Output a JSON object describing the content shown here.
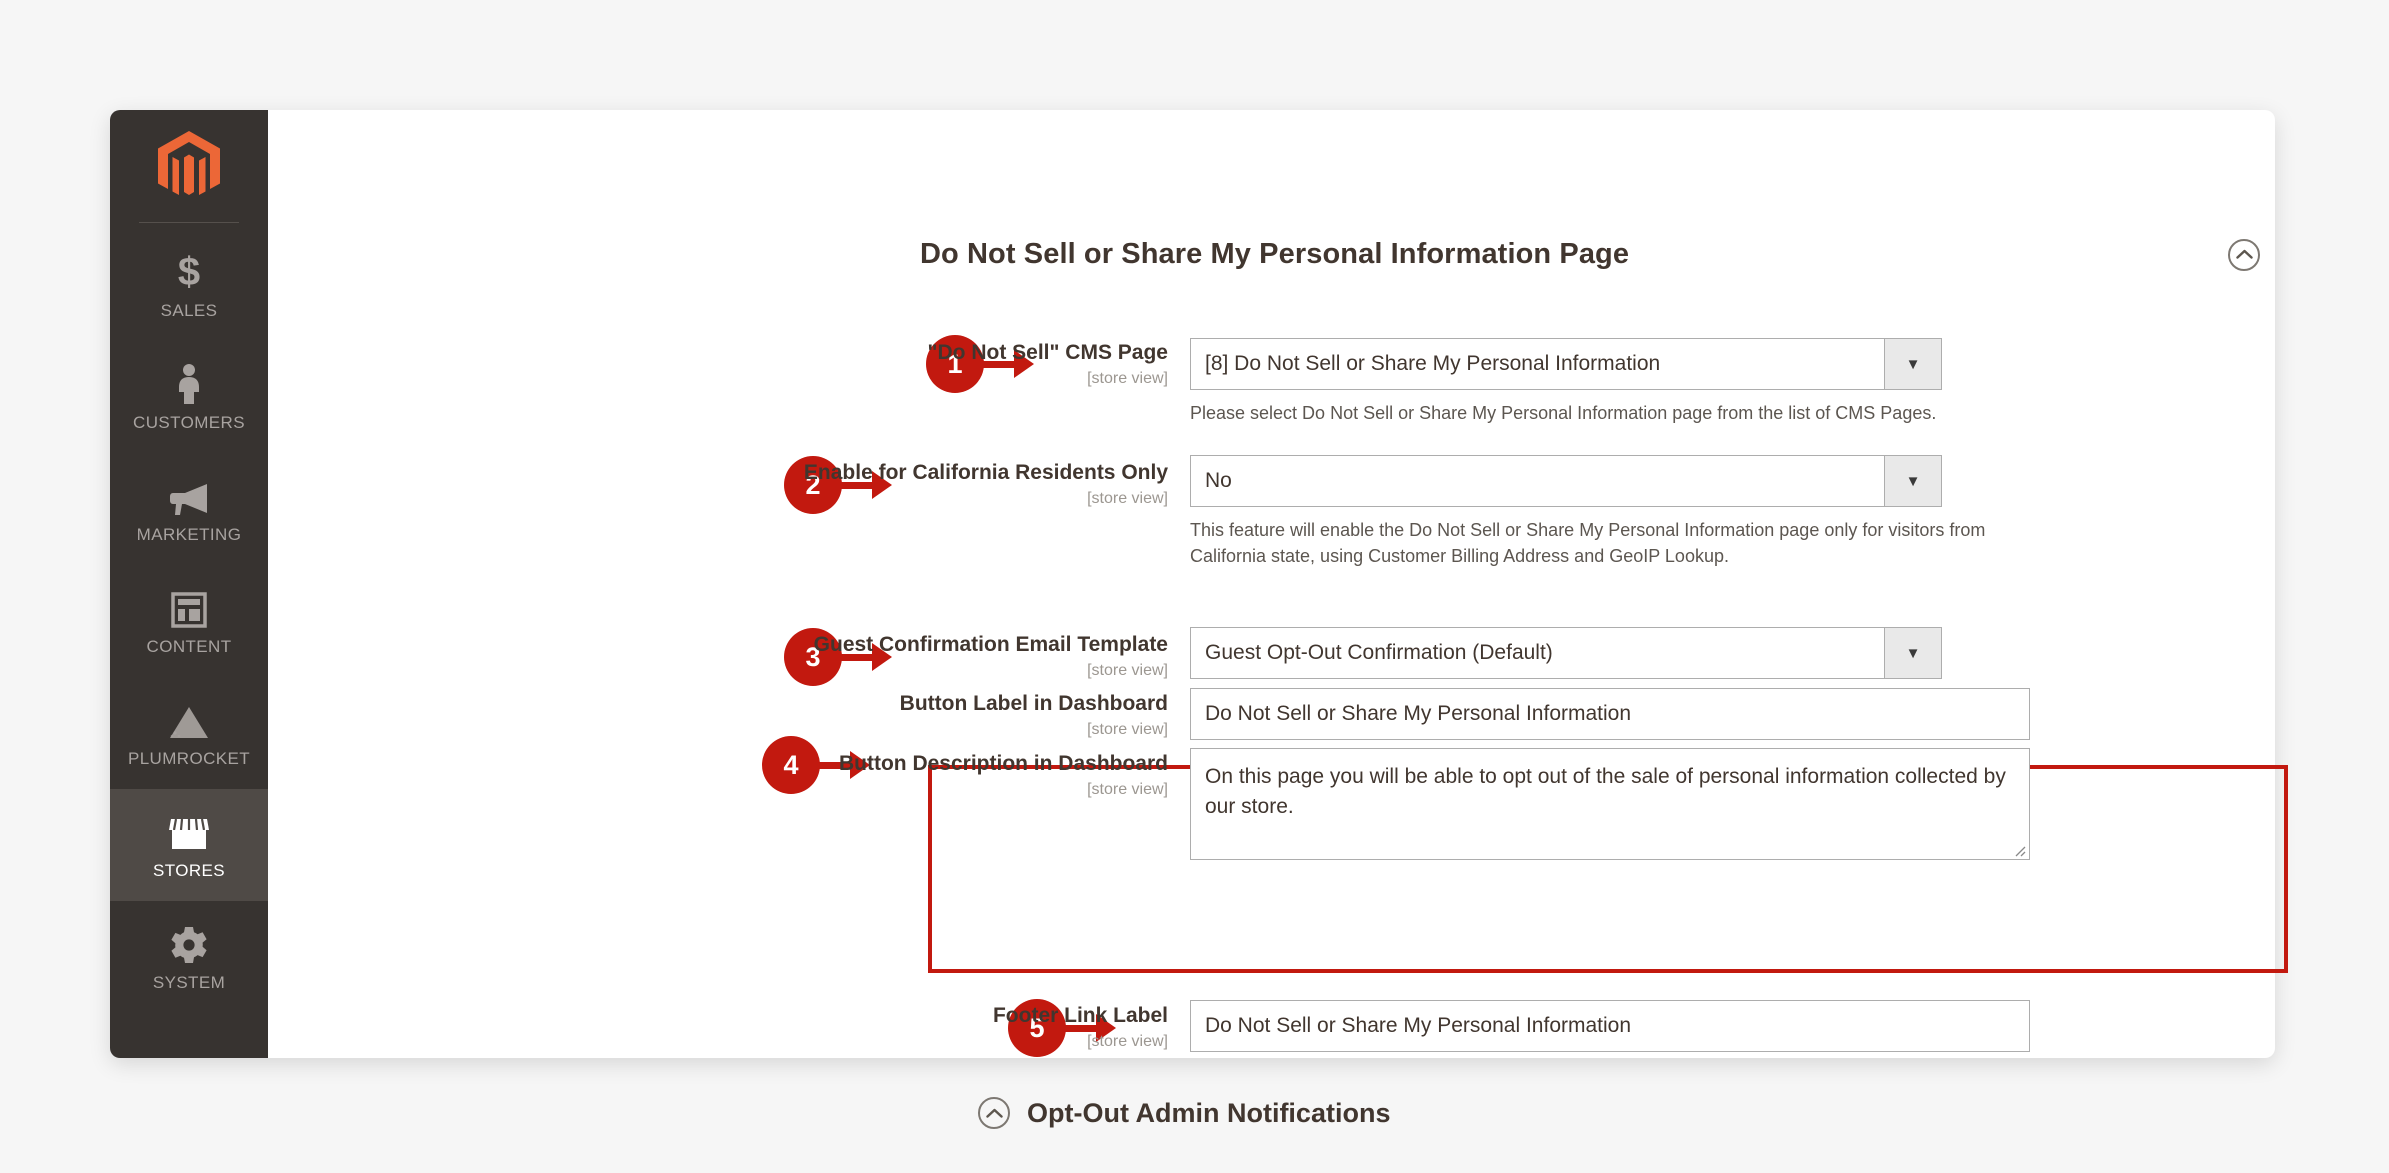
{
  "sidebar": {
    "logo_icon": "magento-logo-icon",
    "items": [
      {
        "label": "SALES",
        "icon": "dollar-icon",
        "active": false
      },
      {
        "label": "CUSTOMERS",
        "icon": "person-icon",
        "active": false
      },
      {
        "label": "MARKETING",
        "icon": "megaphone-icon",
        "active": false
      },
      {
        "label": "CONTENT",
        "icon": "layout-icon",
        "active": false
      },
      {
        "label": "PLUMROCKET",
        "icon": "pyramid-icon",
        "active": false
      },
      {
        "label": "STORES",
        "icon": "storefront-icon",
        "active": true
      },
      {
        "label": "SYSTEM",
        "icon": "gear-icon",
        "active": false
      }
    ]
  },
  "section": {
    "title": "Do Not Sell or Share My Personal Information Page",
    "collapse_icon": "chevron-up-circle-icon"
  },
  "fields": {
    "cms_page": {
      "label": "\"Do Not Sell\" CMS Page",
      "scope": "[store view]",
      "value": "[8] Do Not Sell or Share My Personal Information",
      "hint": "Please select Do Not Sell or Share My Personal Information page from the list of CMS Pages.",
      "marker": "1"
    },
    "california_only": {
      "label": "Enable for California Residents Only",
      "scope": "[store view]",
      "value": "No",
      "hint": "This feature will enable the Do Not Sell or Share My Personal Information page only for visitors from California state, using Customer Billing Address and GeoIP Lookup.",
      "marker": "2"
    },
    "guest_email_template": {
      "label": "Guest Confirmation Email Template",
      "scope": "[store view]",
      "value": "Guest Opt-Out Confirmation (Default)",
      "marker": "3"
    },
    "button_label": {
      "label": "Button Label in Dashboard",
      "scope": "[store view]",
      "value": "Do Not Sell or Share My Personal Information"
    },
    "button_description": {
      "label": "Button Description in Dashboard",
      "scope": "[store view]",
      "value": "On this page you will be able to opt out of the sale of personal information collected by our store.",
      "marker": "4"
    },
    "footer_link_label": {
      "label": "Footer Link Label",
      "scope": "[store view]",
      "value": "Do Not Sell or Share My Personal Information",
      "marker": "5"
    }
  },
  "subsection": {
    "title": "Opt-Out Admin Notifications",
    "toggle_icon": "chevron-up-circle-icon"
  },
  "colors": {
    "marker_red": "#c2190f",
    "sidebar_bg": "#373330",
    "magento_orange": "#ec6737"
  }
}
